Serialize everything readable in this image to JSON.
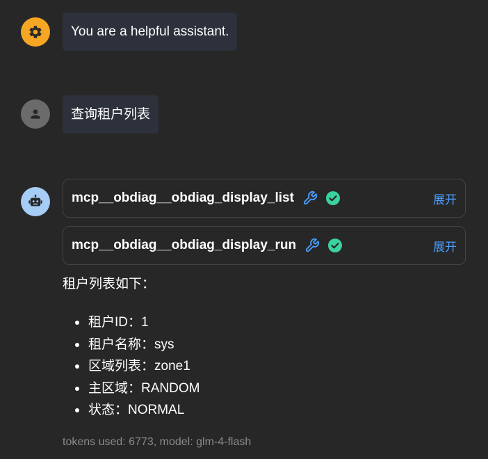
{
  "messages": {
    "system": {
      "text": "You are a helpful assistant.",
      "avatar_icon": "gear-icon",
      "avatar_color": "#f5a623"
    },
    "user": {
      "text": "查询租户列表",
      "avatar_icon": "person-icon",
      "avatar_color": "#6b6b6b"
    },
    "assistant": {
      "avatar_icon": "robot-icon",
      "avatar_color": "#a6cdf5",
      "tool_calls": [
        {
          "name": "mcp__obdiag__obdiag_display_list",
          "tool_icon": "wrench-icon",
          "status_icon": "check-circle-icon",
          "expand_label": "展开"
        },
        {
          "name": "mcp__obdiag__obdiag_display_run",
          "tool_icon": "wrench-icon",
          "status_icon": "check-circle-icon",
          "expand_label": "展开"
        }
      ],
      "reply_intro": "租户列表如下：",
      "reply_items": [
        "租户ID：1",
        "租户名称：sys",
        "区域列表：zone1",
        "主区域：RANDOM",
        "状态：NORMAL"
      ],
      "footer": "tokens used: 6773, model: glm-4-flash"
    }
  },
  "colors": {
    "background": "#272727",
    "bubble": "#2c313b",
    "accent": "#4a9eff",
    "success": "#3ad29f"
  }
}
